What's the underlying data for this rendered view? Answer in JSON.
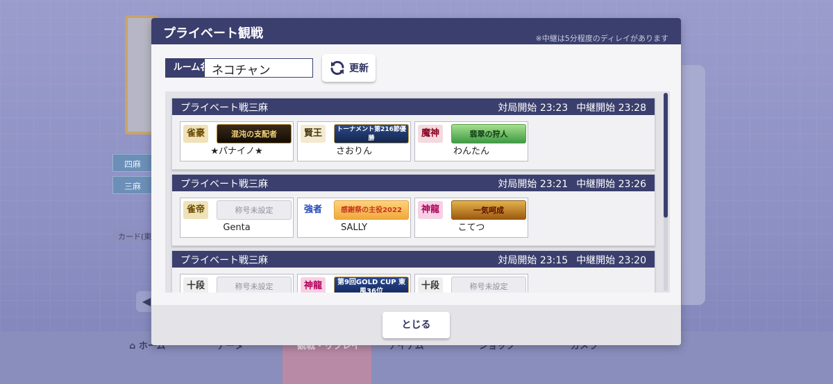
{
  "background": {
    "tags": [
      "四麻",
      "三麻"
    ],
    "card_label": "カード(東",
    "nav": [
      "ホーム",
      "データ",
      "観戦・リプレイ",
      "アイテム",
      "ショップ",
      "カメラ"
    ]
  },
  "modal": {
    "title": "プライベート観戦",
    "note": "※中継は5分程度のディレイがあります",
    "room_label": "ルーム名",
    "room_value": "ネコチャン",
    "refresh_label": "更新",
    "close_label": "とじる"
  },
  "rooms": [
    {
      "name": "プライベート戦三麻",
      "start_label": "対局開始",
      "start_time": "23:23",
      "relay_label": "中継開始",
      "relay_time": "23:28",
      "players": [
        {
          "rank": "雀豪",
          "title": "混沌の支配者",
          "name": "★パナイノ★"
        },
        {
          "rank": "賢王",
          "title": "トーナメント第216節優勝",
          "name": "さおりん"
        },
        {
          "rank": "魔神",
          "title": "翡翠の狩人",
          "name": "わんたん"
        }
      ]
    },
    {
      "name": "プライベート戦三麻",
      "start_label": "対局開始",
      "start_time": "23:21",
      "relay_label": "中継開始",
      "relay_time": "23:26",
      "players": [
        {
          "rank": "雀帝",
          "title": "称号未設定",
          "name": "Genta"
        },
        {
          "rank": "強者",
          "title": "感謝祭の主役2022",
          "name": "SALLY"
        },
        {
          "rank": "神龍",
          "title": "一気呵成",
          "name": "こてつ"
        }
      ]
    },
    {
      "name": "プライベート戦三麻",
      "start_label": "対局開始",
      "start_time": "23:15",
      "relay_label": "中継開始",
      "relay_time": "23:20",
      "players": [
        {
          "rank": "十段",
          "title": "称号未設定",
          "name": ""
        },
        {
          "rank": "神龍",
          "title": "第9回GOLD CUP 東風36位",
          "name": ""
        },
        {
          "rank": "十段",
          "title": "称号未設定",
          "name": ""
        }
      ]
    }
  ],
  "colors": {
    "header": "#3b3f6e",
    "accent": "#2f3360"
  }
}
